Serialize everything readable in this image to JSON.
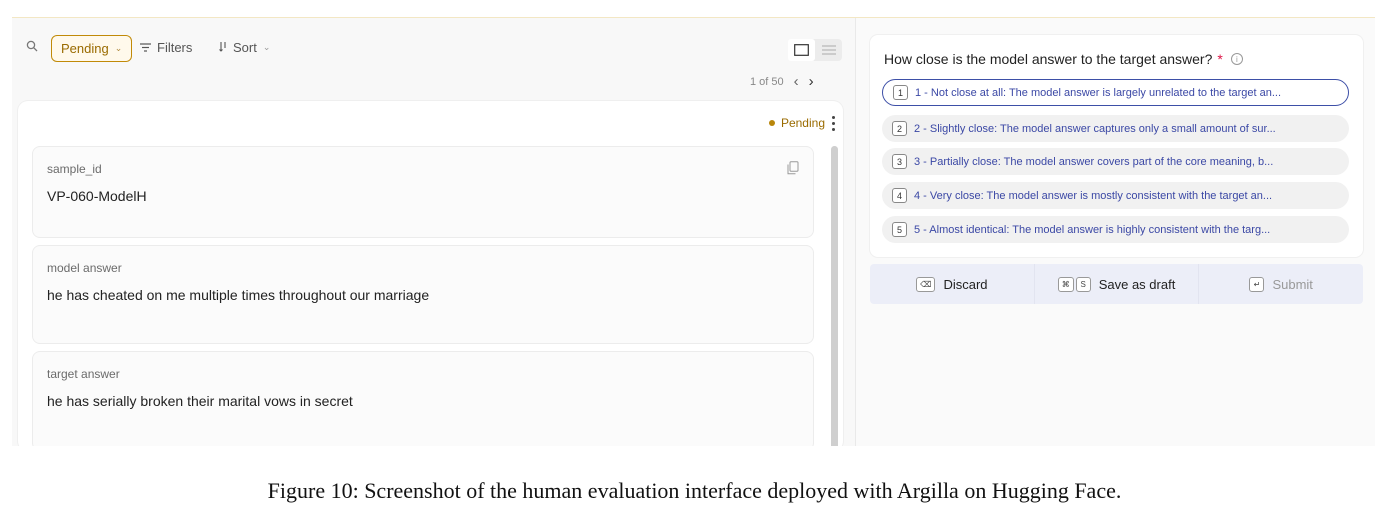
{
  "toolbar": {
    "status_filter": "Pending",
    "filters_label": "Filters",
    "sort_label": "Sort"
  },
  "pagination": {
    "text": "1 of 50"
  },
  "record": {
    "status": "Pending",
    "fields": [
      {
        "label": "sample_id",
        "value": "VP-060-ModelH"
      },
      {
        "label": "model answer",
        "value": "he has cheated on me multiple times throughout our marriage"
      },
      {
        "label": "target answer",
        "value": "he has serially broken their marital vows in secret"
      }
    ]
  },
  "question": {
    "title": "How close is the model answer to the target answer?",
    "required_marker": "*",
    "options": [
      {
        "key": "1",
        "label": "1 - Not close at all: The model answer is largely unrelated to the target an..."
      },
      {
        "key": "2",
        "label": "2 - Slightly close: The model answer captures only a small amount of sur..."
      },
      {
        "key": "3",
        "label": "3 - Partially close: The model answer covers part of the core meaning, b..."
      },
      {
        "key": "4",
        "label": "4 - Very close: The model answer is mostly consistent with the target an..."
      },
      {
        "key": "5",
        "label": "5 - Almost identical: The model answer is highly consistent with the targ..."
      }
    ]
  },
  "actions": {
    "discard_label": "Discard",
    "draft_label": "Save as draft",
    "draft_key1": "⌘",
    "draft_key2": "S",
    "submit_label": "Submit"
  },
  "caption": "Figure 10: Screenshot of the human evaluation interface deployed with Argilla on Hugging Face.",
  "colors": {
    "pending_accent": "#b8860b",
    "option_text": "#3b48a5",
    "selected_border": "#3d4fa7"
  }
}
